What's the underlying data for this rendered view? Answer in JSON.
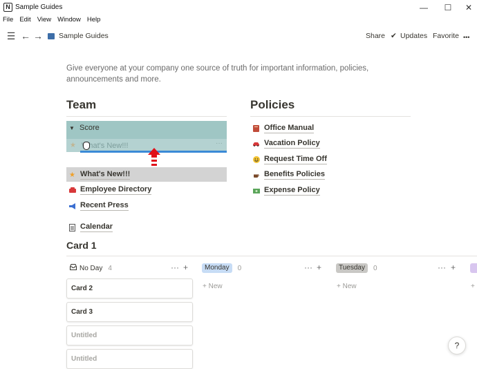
{
  "window": {
    "title": "Sample Guides",
    "logo_letter": "N",
    "minimize": "—",
    "maximize": "☐",
    "close": "✕"
  },
  "menu": [
    "File",
    "Edit",
    "View",
    "Window",
    "Help"
  ],
  "nav": {
    "breadcrumb": "Sample Guides",
    "share": "Share",
    "updates": "Updates",
    "favorite": "Favorite",
    "more": "•••"
  },
  "intro": "Give everyone at your company one source of truth for important information, policies, announcements and more.",
  "team": {
    "heading": "Team",
    "toggle_label": "Score",
    "dragging_label": "What's New!!!",
    "items": [
      {
        "label": "What's New!!!",
        "icon": "star-icon"
      },
      {
        "label": "Employee Directory",
        "icon": "phone-icon"
      },
      {
        "label": "Recent Press",
        "icon": "megaphone-icon"
      },
      {
        "label": "Calendar",
        "icon": "document-icon"
      }
    ]
  },
  "policies": {
    "heading": "Policies",
    "items": [
      {
        "label": "Office Manual",
        "icon": "book-icon"
      },
      {
        "label": "Vacation Policy",
        "icon": "car-icon"
      },
      {
        "label": "Request Time Off",
        "icon": "smiley-icon"
      },
      {
        "label": "Benefits Policies",
        "icon": "coffee-icon"
      },
      {
        "label": "Expense Policy",
        "icon": "money-icon"
      }
    ]
  },
  "board": {
    "title": "Card 1",
    "groups": [
      {
        "name": "No Day",
        "count": "4",
        "color": "#ffffff"
      },
      {
        "name": "Monday",
        "count": "0",
        "color": "#c7dcf5"
      },
      {
        "name": "Tuesday",
        "count": "0",
        "color": "#c9c8c5"
      }
    ],
    "new_label": "New",
    "cards": [
      "Card 2",
      "Card 3",
      "Untitled",
      "Untitled"
    ]
  },
  "help": "?",
  "colors": {
    "drag_highlight": "#9fc6c4",
    "drop_indicator": "#3a8ad6",
    "arrow": "#e0101a"
  }
}
